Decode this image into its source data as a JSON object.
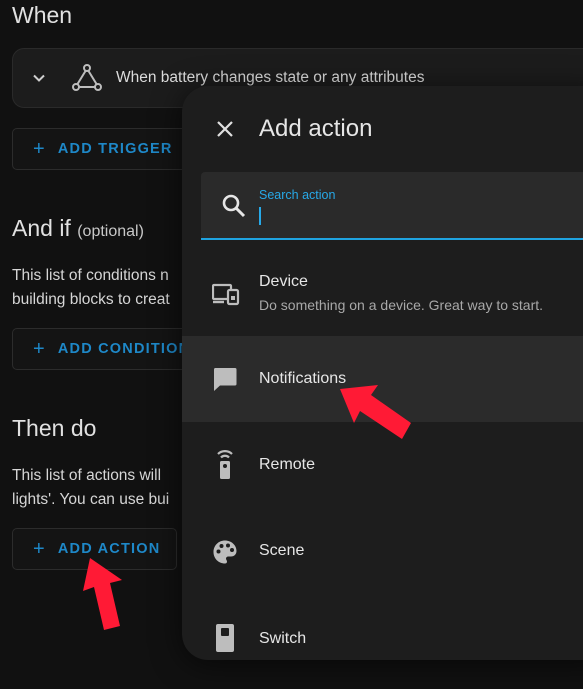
{
  "editor": {
    "when_title": "When",
    "trigger_text": "When battery changes state or any attributes",
    "add_trigger_label": "ADD TRIGGER",
    "and_if_title": "And if",
    "and_if_optional": "(optional)",
    "and_if_desc_line1": "This list of conditions n",
    "and_if_desc_line2": "building blocks to creat",
    "add_condition_label": "ADD CONDITION",
    "then_do_title": "Then do",
    "then_do_desc_line1": "This list of actions will",
    "then_do_desc_line2": "lights'. You can use bui",
    "add_action_label": "ADD ACTION"
  },
  "dialog": {
    "title": "Add action",
    "search_label": "Search action",
    "items": [
      {
        "title": "Device",
        "subtitle": "Do something on a device. Great way to start.",
        "icon": "device-icon"
      },
      {
        "title": "Notifications",
        "subtitle": "",
        "icon": "message-icon"
      },
      {
        "title": "Remote",
        "subtitle": "",
        "icon": "remote-icon"
      },
      {
        "title": "Scene",
        "subtitle": "",
        "icon": "palette-icon"
      },
      {
        "title": "Switch",
        "subtitle": "",
        "icon": "switch-icon"
      }
    ]
  },
  "colors": {
    "accent": "#1e88c8",
    "search_accent": "#27a9e8",
    "annotation_arrow": "#ff1a35",
    "dialog_bg": "#1d1d1d",
    "page_bg": "#111111"
  }
}
